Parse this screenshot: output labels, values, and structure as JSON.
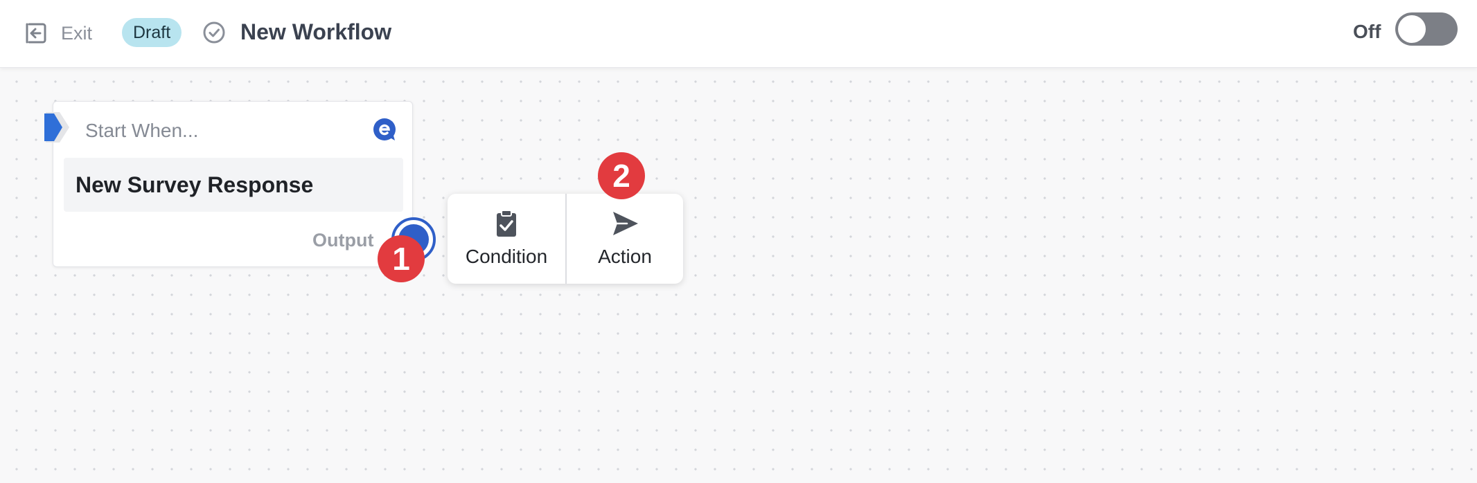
{
  "header": {
    "exit_label": "Exit",
    "status_badge": "Draft",
    "workflow_title": "New Workflow",
    "toggle_label": "Off",
    "toggle_on": false
  },
  "trigger_node": {
    "start_label": "Start When...",
    "event": "New Survey Response",
    "output_label": "Output"
  },
  "popup_menu": {
    "items": [
      {
        "label": "Condition",
        "icon": "clipboard-check-icon"
      },
      {
        "label": "Action",
        "icon": "send-icon"
      }
    ]
  },
  "step_badges": [
    "1",
    "2"
  ],
  "colors": {
    "accent": "#2f5fc8",
    "badge_red": "#e23b3f",
    "draft_badge_bg": "#b8e4ef",
    "toggle_off": "#7c7f86"
  }
}
